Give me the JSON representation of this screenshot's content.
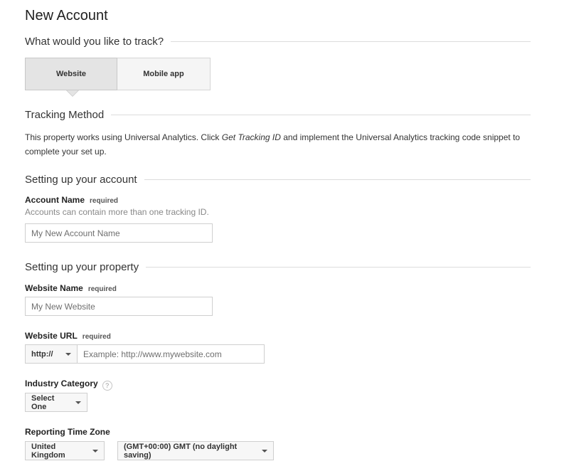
{
  "page": {
    "title": "New Account"
  },
  "track": {
    "heading": "What would you like to track?",
    "options": [
      {
        "label": "Website",
        "selected": true
      },
      {
        "label": "Mobile app",
        "selected": false
      }
    ]
  },
  "tracking_method": {
    "heading": "Tracking Method",
    "text_before": "This property works using Universal Analytics. Click ",
    "text_emphasis": "Get Tracking ID",
    "text_after": " and implement the Universal Analytics tracking code snippet to complete your set up."
  },
  "account": {
    "heading": "Setting up your account",
    "name_label": "Account Name",
    "required_label": "required",
    "hint": "Accounts can contain more than one tracking ID.",
    "name_placeholder": "My New Account Name"
  },
  "property": {
    "heading": "Setting up your property",
    "website_name_label": "Website Name",
    "website_name_required": "required",
    "website_name_placeholder": "My New Website",
    "website_url_label": "Website URL",
    "website_url_required": "required",
    "protocol_value": "http://",
    "website_url_placeholder": "Example: http://www.mywebsite.com",
    "industry_label": "Industry Category",
    "industry_help": "?",
    "industry_value": "Select One",
    "timezone_label": "Reporting Time Zone",
    "country_value": "United Kingdom",
    "timezone_value": "(GMT+00:00) GMT (no daylight saving)"
  }
}
